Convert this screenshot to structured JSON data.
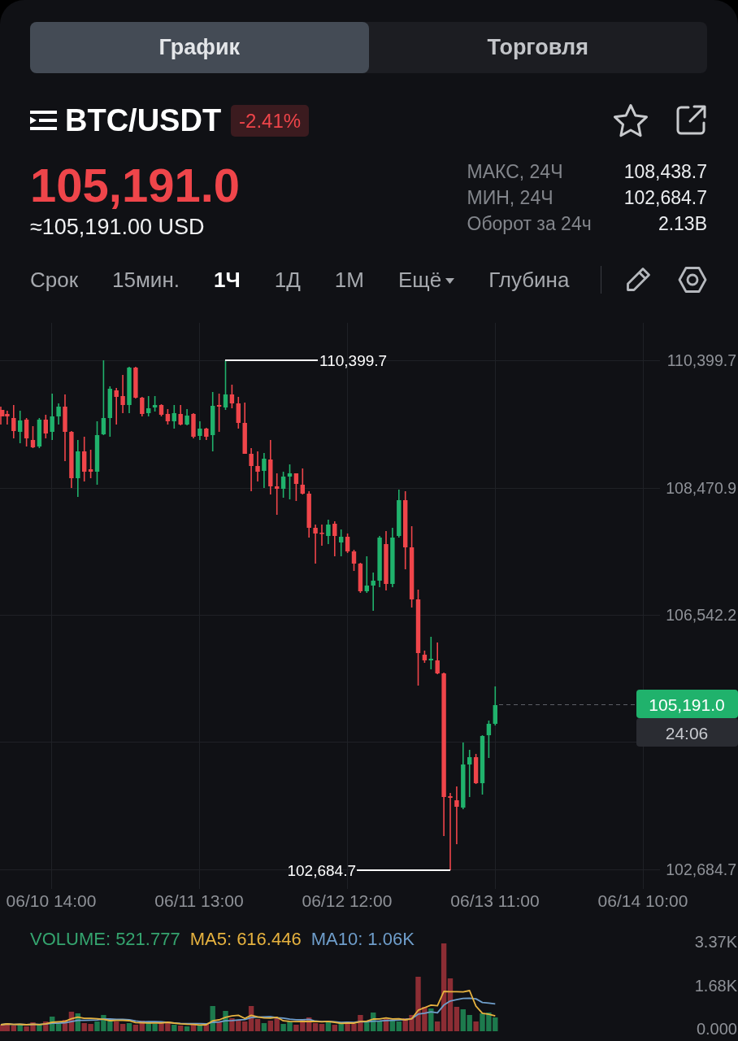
{
  "tabs": [
    {
      "label": "График",
      "selected": true
    },
    {
      "label": "Торговля",
      "selected": false
    }
  ],
  "pair": {
    "symbol": "BTC/USDT",
    "change": "-2.41%",
    "favorite": false
  },
  "price": {
    "last": "105,191.0",
    "fiat": "≈105,191.00 USD",
    "falling": true
  },
  "stats": [
    {
      "label": "МАКС, 24Ч",
      "value": "108,438.7"
    },
    {
      "label": "МИН, 24Ч",
      "value": "102,684.7"
    },
    {
      "label": "Оборот за 24ч",
      "value": "2.13B"
    }
  ],
  "intervals": [
    {
      "label": "Срок",
      "kind": "option",
      "selected": false
    },
    {
      "label": "15мин.",
      "kind": "option",
      "selected": false
    },
    {
      "label": "1Ч",
      "kind": "option",
      "selected": true
    },
    {
      "label": "1Д",
      "kind": "option",
      "selected": false
    },
    {
      "label": "1М",
      "kind": "option",
      "selected": false
    },
    {
      "label": "Ещё",
      "kind": "dropdown",
      "selected": false
    },
    {
      "label": "Глубина",
      "kind": "option",
      "selected": false
    }
  ],
  "chart": {
    "price_axis": [
      "110,399.7",
      "108,470.9",
      "106,542.2",
      "102,684.7"
    ],
    "time_axis": [
      "06/10 14:00",
      "06/11 13:00",
      "06/12 12:00",
      "06/13 11:00",
      "06/14 10:00"
    ],
    "high_marker": "110,399.7",
    "low_marker": "102,684.7",
    "last_price": "105,191.0",
    "countdown": "24:06"
  },
  "volume": {
    "legend": [
      {
        "label": "VOLUME: 521.777",
        "color": "#35a56f"
      },
      {
        "label": "MA5: 616.446",
        "color": "#e6b23f"
      },
      {
        "label": "MA10: 1.06K",
        "color": "#6f9ecb"
      }
    ],
    "axis": [
      "3.37K",
      "1.68K",
      "0.000"
    ]
  }
}
